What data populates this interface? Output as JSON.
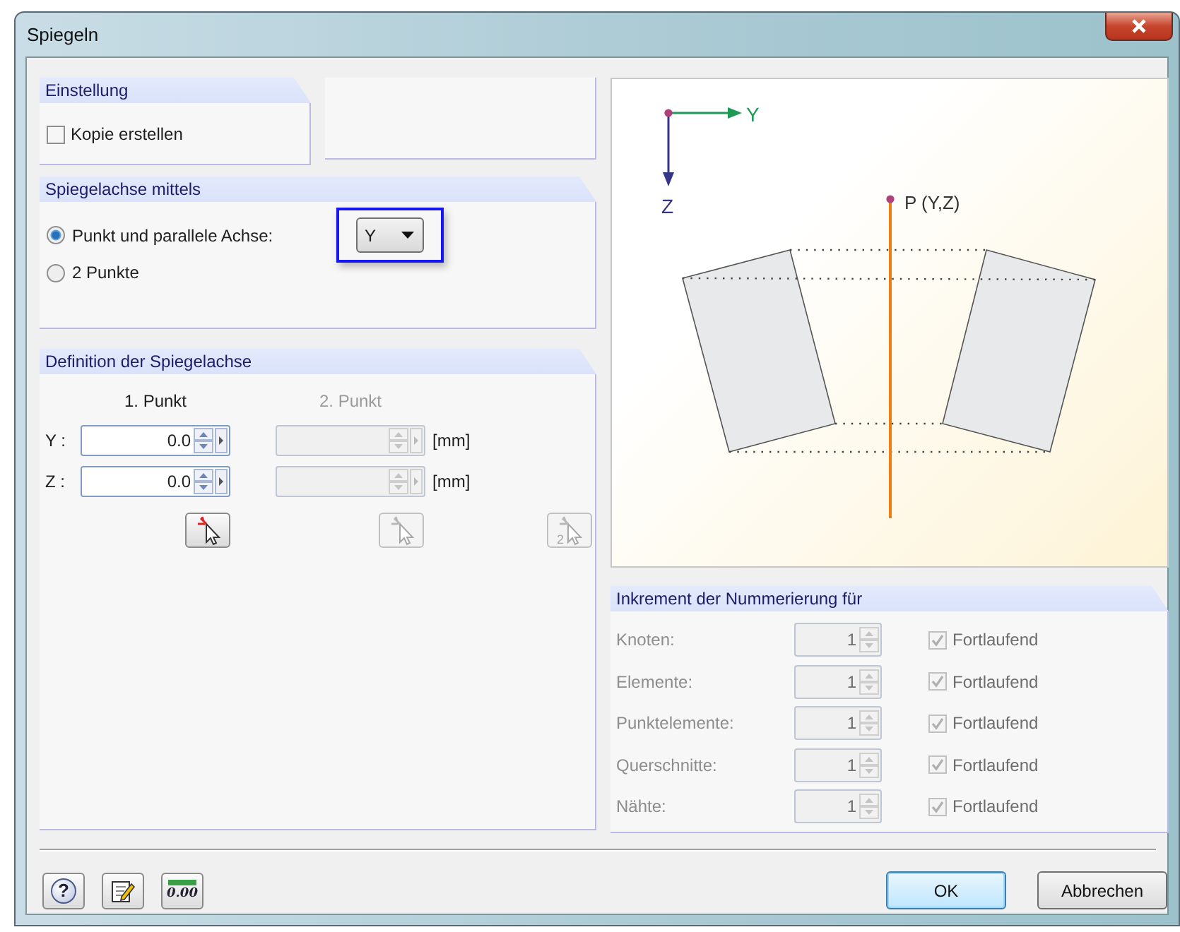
{
  "window": {
    "title": "Spiegeln"
  },
  "settings": {
    "title": "Einstellung",
    "copy": {
      "label": "Kopie erstellen",
      "checked": false
    }
  },
  "axis_mode": {
    "title": "Spiegelachse mittels",
    "options": [
      {
        "label": "Punkt und parallele Achse:",
        "selected": true
      },
      {
        "label": "2 Punkte",
        "selected": false
      }
    ],
    "axis": {
      "value": "Y",
      "focused": true
    }
  },
  "definition": {
    "title": "Definition der Spiegelachse",
    "columns": [
      {
        "label": "1. Punkt",
        "disabled": false
      },
      {
        "label": "2. Punkt",
        "disabled": true
      }
    ],
    "rows": [
      {
        "label": "Y :",
        "point_1": "0.0",
        "unit": "[mm]"
      },
      {
        "label": "Z :",
        "point_1": "0.0",
        "unit": "[mm]"
      }
    ],
    "pick_buttons": [
      {
        "kind": "pick",
        "disabled": false
      },
      {
        "kind": "pick",
        "disabled": true
      },
      {
        "kind": "pick-two",
        "glyph": "2",
        "disabled": true
      }
    ]
  },
  "diagram": {
    "y_axis": "Y",
    "z_axis": "Z",
    "point": "P (Y,Z)"
  },
  "increment": {
    "title": "Inkrement der Nummerierung für",
    "disabled": true,
    "rows": [
      {
        "label": "Knoten:",
        "value": "1",
        "continuous": {
          "label": "Fortlaufend",
          "checked": true
        }
      },
      {
        "label": "Elemente:",
        "value": "1",
        "continuous": {
          "label": "Fortlaufend",
          "checked": true
        }
      },
      {
        "label": "Punktelemente:",
        "value": "1",
        "continuous": {
          "label": "Fortlaufend",
          "checked": true
        }
      },
      {
        "label": "Querschnitte:",
        "value": "1",
        "continuous": {
          "label": "Fortlaufend",
          "checked": true
        }
      },
      {
        "label": "Nähte:",
        "value": "1",
        "continuous": {
          "label": "Fortlaufend",
          "checked": true
        }
      }
    ]
  },
  "footer": {
    "tools": [
      {
        "kind": "help",
        "glyph": "?"
      },
      {
        "kind": "edit"
      },
      {
        "kind": "units",
        "glyph": "0.00"
      }
    ],
    "buttons": [
      {
        "label": "OK",
        "default": true
      },
      {
        "label": "Abbrechen",
        "default": false
      }
    ]
  }
}
